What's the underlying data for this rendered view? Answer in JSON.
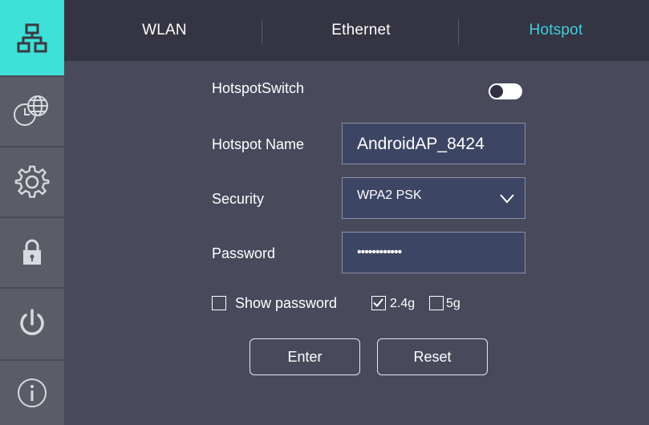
{
  "tabs": [
    "WLAN",
    "Ethernet",
    "Hotspot"
  ],
  "sidebar": {
    "items": [
      {
        "icon": "network-icon"
      },
      {
        "icon": "clock-globe-icon"
      },
      {
        "icon": "gear-icon"
      },
      {
        "icon": "lock-icon"
      },
      {
        "icon": "power-icon"
      },
      {
        "icon": "info-icon"
      }
    ]
  },
  "form": {
    "switch_label": "HotspotSwitch",
    "switch_on": false,
    "name_label": "Hotspot Name",
    "name_value": "AndroidAP_8424",
    "security_label": "Security",
    "security_value": "WPA2 PSK",
    "password_label": "Password",
    "password_value": "••••••••••••",
    "show_password_label": "Show password",
    "show_password_checked": false,
    "band_24_label": "2.4g",
    "band_24_checked": true,
    "band_5_label": "5g",
    "band_5_checked": false
  },
  "buttons": {
    "enter": "Enter",
    "reset": "Reset"
  },
  "colors": {
    "accent": "#3ee0d8",
    "active_tab": "#3ecfe0",
    "panel": "#484a5c",
    "tabbar": "#343442",
    "sidebar": "#5b5c66"
  }
}
